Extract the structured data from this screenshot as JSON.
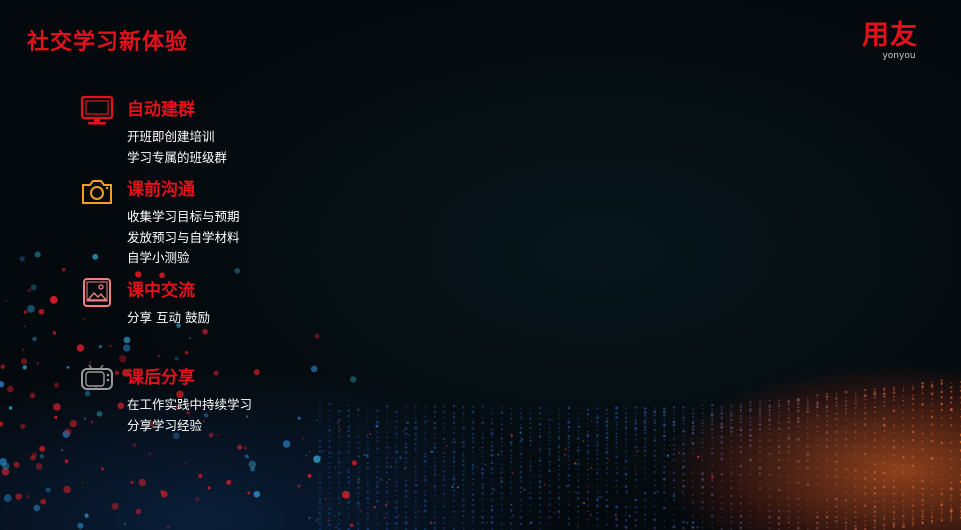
{
  "header": {
    "title": "社交学习新体验"
  },
  "logo": {
    "cn": "用友",
    "en": "yonyou",
    "color": "#e4101c"
  },
  "sections": [
    {
      "icon": "monitor-icon",
      "title": "自动建群",
      "lines": [
        "开班即创建培训",
        "学习专属的班级群"
      ]
    },
    {
      "icon": "camera-icon",
      "title": "课前沟通",
      "lines": [
        "收集学习目标与预期",
        "发放预习与自学材料",
        "自学小测验"
      ]
    },
    {
      "icon": "image-icon",
      "title": "课中交流",
      "lines": [
        "分享  互动  鼓励"
      ]
    },
    {
      "icon": "tv-icon",
      "title": "课后分享",
      "lines": [
        "在工作实践中持续学习",
        "分享学习经验"
      ]
    }
  ],
  "colors": {
    "accent": "#e4101c",
    "text": "#ffffff",
    "camera": "#f0a020",
    "image": "#f08080",
    "tv": "#9a9a9a"
  }
}
